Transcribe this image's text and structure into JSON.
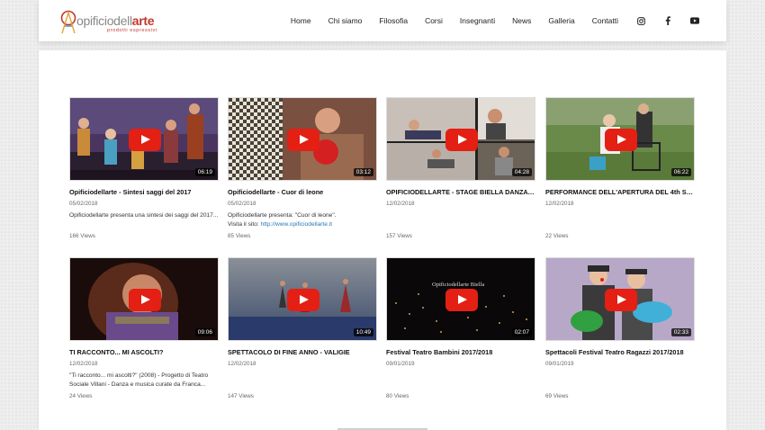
{
  "brand": {
    "logo_part1": "opificiodell",
    "logo_part2": "arte",
    "tagline": "prodotti espressivi"
  },
  "nav": {
    "items": [
      "Home",
      "Chi siamo",
      "Filosofia",
      "Corsi",
      "Insegnanti",
      "News",
      "Galleria",
      "Contatti"
    ],
    "social": [
      "instagram-icon",
      "facebook-icon",
      "youtube-icon"
    ]
  },
  "videos": [
    {
      "title": "Opificiodellarte - Sintesi saggi del 2017",
      "date": "05/02/2018",
      "duration": "06:19",
      "desc": "Opificiodellarte presenta una sintesi dei saggi del 2017...",
      "views": "166 Views"
    },
    {
      "title": "Opificiodellarte - Cuor di leone",
      "date": "05/02/2018",
      "duration": "03:12",
      "desc": "Opificiodellarte presenta: \"Cuor di leone\".",
      "desc2": "Visita il sito: ",
      "link": "http://www.opificiodellarte.it",
      "views": "85 Views"
    },
    {
      "title": "OPIFICIODELLARTE - STAGE BIELLA DANZA 2...",
      "date": "12/02/2018",
      "duration": "04:28",
      "desc": "",
      "views": "157 Views"
    },
    {
      "title": "PERFORMANCE DELL'APERTURA DEL 4th SOCI...",
      "date": "12/02/2018",
      "duration": "06:22",
      "desc": "",
      "views": "22 Views"
    },
    {
      "title": "TI RACCONTO... MI ASCOLTI?",
      "date": "12/02/2018",
      "duration": "09:06",
      "desc": "\"Ti racconto... mi ascolti?\" (2008) - Progetto di Teatro Sociale Villani - Danza e musica curate da Franca...",
      "views": "24 Views"
    },
    {
      "title": "SPETTACOLO DI FINE ANNO - VALIGIE",
      "date": "12/02/2018",
      "duration": "10:49",
      "desc": "",
      "views": "147 Views"
    },
    {
      "title": "Festival Teatro Bambini 2017/2018",
      "date": "09/01/2019",
      "duration": "02:07",
      "desc": "",
      "views": "80 Views",
      "overlay_text": "Opificiodellarte Biella"
    },
    {
      "title": "Spettacoli Festival Teatro Ragazzi 2017/2018",
      "date": "09/01/2019",
      "duration": "02:33",
      "desc": "",
      "views": "69 Views"
    }
  ],
  "colors": {
    "accent": "#c0392b",
    "play": "#e41f13",
    "link": "#2a7ab8"
  }
}
